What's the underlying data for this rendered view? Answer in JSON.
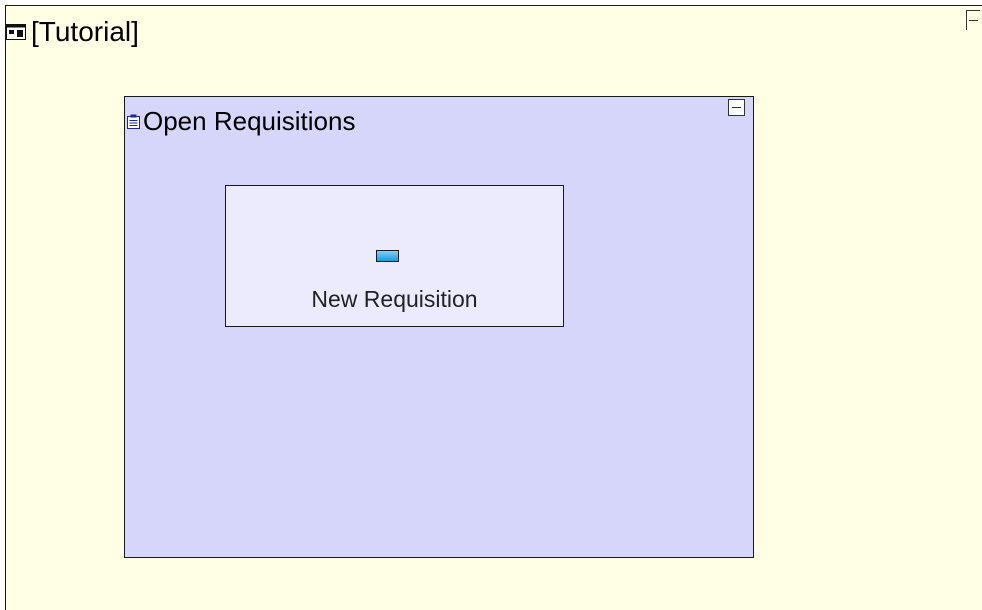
{
  "diagram": {
    "outer": {
      "title": "[Tutorial]",
      "icon": "window-icon",
      "background_color": "#ffffe6"
    },
    "state": {
      "title": "Open Requisitions",
      "icon": "clipboard-icon",
      "background_color": "#d6d6fa"
    },
    "action": {
      "label": "New Requisition",
      "icon": "button-icon",
      "background_color": "#ebebfd",
      "icon_color": "#1a9ae0"
    }
  }
}
